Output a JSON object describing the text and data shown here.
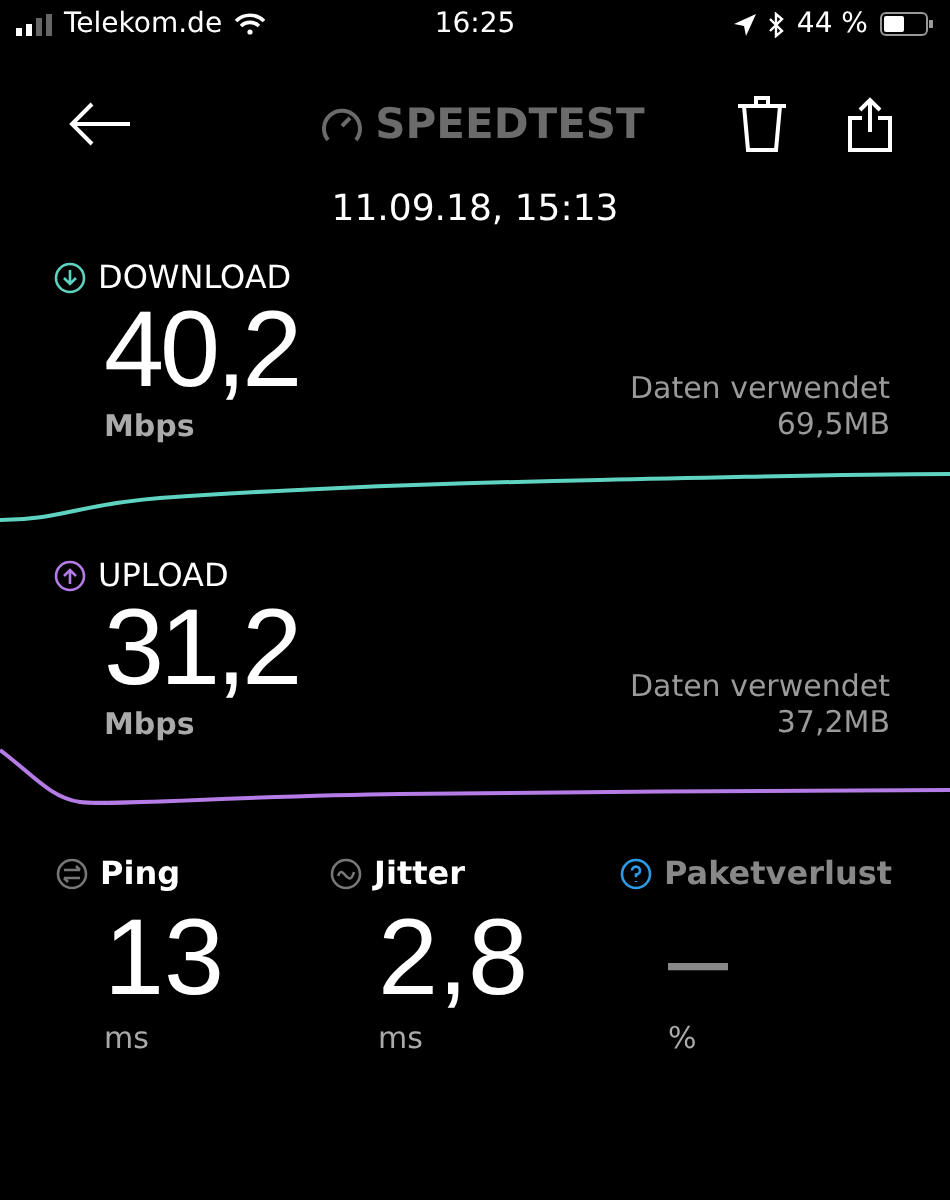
{
  "status_bar": {
    "carrier": "Telekom.de",
    "time": "16:25",
    "battery": "44 %"
  },
  "nav": {
    "logo": "SPEEDTEST"
  },
  "date": "11.09.18, 15:13",
  "results": [
    {
      "kind": "download",
      "label": "DOWNLOAD",
      "value": "40,2",
      "unit": "Mbps",
      "data_label": "Daten verwendet",
      "data_value": "69,5MB",
      "color": "#5fd3c1"
    },
    {
      "kind": "upload",
      "label": "UPLOAD",
      "value": "31,2",
      "unit": "Mbps",
      "data_label": "Daten verwendet",
      "data_value": "37,2MB",
      "color": "#b57be6"
    }
  ],
  "metrics": [
    {
      "kind": "ping",
      "label": "Ping",
      "value": "13",
      "unit": "ms",
      "disabled": false
    },
    {
      "kind": "jitter",
      "label": "Jitter",
      "value": "2,8",
      "unit": "ms",
      "disabled": false
    },
    {
      "kind": "loss",
      "label": "Paketverlust",
      "value": "–",
      "unit": "%",
      "disabled": true
    }
  ]
}
